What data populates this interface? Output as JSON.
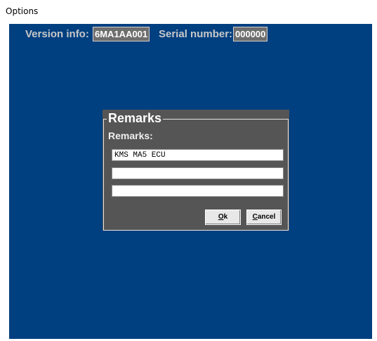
{
  "window": {
    "title": "Options"
  },
  "info": {
    "version_label": "Version info:",
    "version_value": "6MA1AA001",
    "serial_label": "Serial number:",
    "serial_value": "000000"
  },
  "remarks_dialog": {
    "group_title": "Remarks",
    "field_label": "Remarks:",
    "lines": [
      "KMS MA5 ECU",
      "",
      ""
    ],
    "ok_label_accel": "O",
    "ok_label_rest": "k",
    "cancel_label_accel": "C",
    "cancel_label_rest": "ancel"
  },
  "colors": {
    "background": "#003f80",
    "dialog": "#555555"
  }
}
